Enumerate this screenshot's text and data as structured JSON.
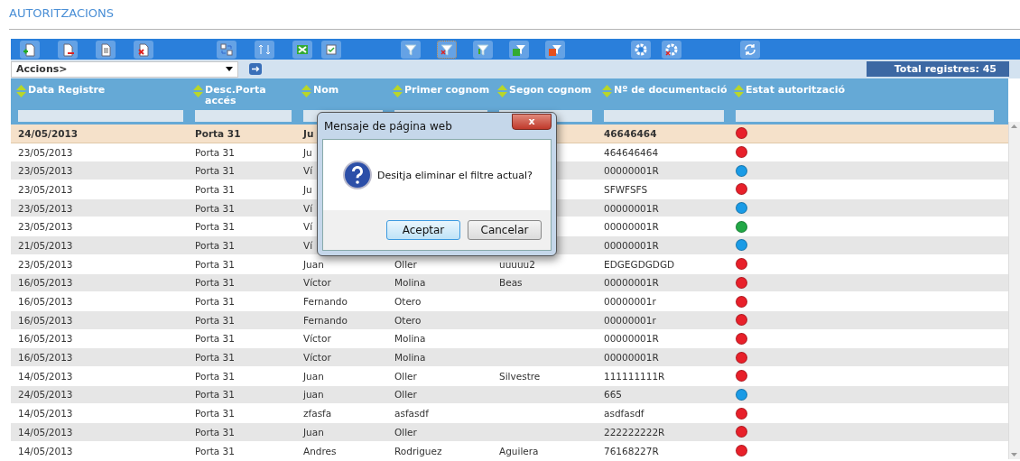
{
  "page_title": "AUTORITZACIONS",
  "actions": {
    "select_value": "Accions>",
    "total": "Total registres: 45"
  },
  "table": {
    "columns": [
      "Data Registre",
      "Desc.Porta accés",
      "Nom",
      "Primer cognom",
      "Segon cognom",
      "Nº de documentació",
      "Estat autorització"
    ],
    "rows": [
      {
        "selected": true,
        "data": "24/05/2013",
        "porta": "Porta 31",
        "nom": "Ju",
        "doc": "46646464",
        "color": "#e8202a"
      },
      {
        "selected": false,
        "data": "23/05/2013",
        "porta": "Porta 31",
        "nom": "Ju",
        "doc": "464646464",
        "color": "#e8202a"
      },
      {
        "selected": false,
        "data": "23/05/2013",
        "porta": "Porta 31",
        "nom": "Ví",
        "doc": "00000001R",
        "color": "#1a9be6"
      },
      {
        "selected": false,
        "data": "23/05/2013",
        "porta": "Porta 31",
        "nom": "Ju",
        "doc": "SFWFSFS",
        "color": "#e8202a"
      },
      {
        "selected": false,
        "data": "23/05/2013",
        "porta": "Porta 31",
        "nom": "Ví",
        "doc": "00000001R",
        "color": "#1a9be6"
      },
      {
        "selected": false,
        "data": "23/05/2013",
        "porta": "Porta 31",
        "nom": "Ví",
        "doc": "00000001R",
        "color": "#22a846"
      },
      {
        "selected": false,
        "data": "21/05/2013",
        "porta": "Porta 31",
        "nom": "Ví",
        "doc": "00000001R",
        "color": "#1a9be6"
      },
      {
        "selected": false,
        "data": "23/05/2013",
        "porta": "Porta 31",
        "nom": "Juan",
        "cognom1": "Oller",
        "cognom2": "uuuuu2",
        "doc": "EDGEGDGDGD",
        "color": "#e8202a"
      },
      {
        "selected": false,
        "data": "16/05/2013",
        "porta": "Porta 31",
        "nom": "Víctor",
        "cognom1": "Molina",
        "cognom2": "Beas",
        "doc": "00000001R",
        "color": "#e8202a"
      },
      {
        "selected": false,
        "data": "16/05/2013",
        "porta": "Porta 31",
        "nom": "Fernando",
        "cognom1": "Otero",
        "doc": "00000001r",
        "color": "#e8202a"
      },
      {
        "selected": false,
        "data": "16/05/2013",
        "porta": "Porta 31",
        "nom": "Fernando",
        "cognom1": "Otero",
        "doc": "00000001r",
        "color": "#e8202a"
      },
      {
        "selected": false,
        "data": "16/05/2013",
        "porta": "Porta 31",
        "nom": "Víctor",
        "cognom1": "Molina",
        "doc": "00000001R",
        "color": "#e8202a"
      },
      {
        "selected": false,
        "data": "16/05/2013",
        "porta": "Porta 31",
        "nom": "Víctor",
        "cognom1": "Molina",
        "doc": "00000001R",
        "color": "#e8202a"
      },
      {
        "selected": false,
        "data": "14/05/2013",
        "porta": "Porta 31",
        "nom": "Juan",
        "cognom1": "Oller",
        "cognom2": "Silvestre",
        "doc": "111111111R",
        "color": "#e8202a"
      },
      {
        "selected": false,
        "data": "24/05/2013",
        "porta": "Porta 31",
        "nom": "juan",
        "cognom1": "Oller",
        "doc": "665",
        "color": "#1a9be6"
      },
      {
        "selected": false,
        "data": "14/05/2013",
        "porta": "Porta 31",
        "nom": "zfasfa",
        "cognom1": "asfasdf",
        "doc": "asdfasdf",
        "color": "#e8202a"
      },
      {
        "selected": false,
        "data": "14/05/2013",
        "porta": "Porta 31",
        "nom": "Juan",
        "cognom1": "Oller",
        "doc": "222222222R",
        "color": "#e8202a"
      },
      {
        "selected": false,
        "data": "14/05/2013",
        "porta": "Porta 31",
        "nom": "Andres",
        "cognom1": "Rodriguez",
        "cognom2": "Aguilera",
        "doc": "76168227R",
        "color": "#e8202a"
      }
    ]
  },
  "dialog": {
    "title": "Mensaje de página web",
    "close": "x",
    "message": "Desitja eliminar el filtre actual?",
    "buttons": [
      {
        "label": "Aceptar",
        "selected": true
      },
      {
        "label": "Cancelar",
        "selected": false
      }
    ]
  }
}
